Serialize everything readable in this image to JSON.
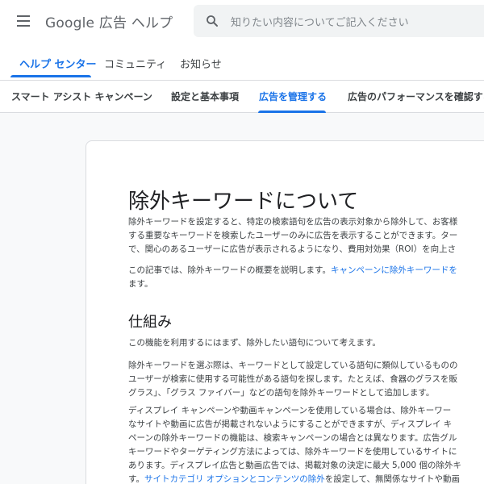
{
  "header": {
    "brand": "Google 広告 ヘルプ",
    "search_placeholder": "知りたい内容についてご記入ください"
  },
  "nav_tabs": [
    {
      "label": "ヘルプ センター",
      "active": true
    },
    {
      "label": "コミュニティ",
      "active": false
    },
    {
      "label": "お知らせ",
      "active": false
    }
  ],
  "sub_tabs": [
    {
      "label": "スマート アシスト キャンペーン",
      "active": false
    },
    {
      "label": "設定と基本事項",
      "active": false
    },
    {
      "label": "広告を管理する",
      "active": true
    },
    {
      "label": "広告のパフォーマンスを確認する",
      "active": false
    }
  ],
  "article": {
    "title": "除外キーワードについて",
    "intro_lines": [
      "除外キーワードを設定すると、特定の検索語句を広告の表示対象から除外して、お客様",
      "する重要なキーワードを検索したユーザーのみに広告を表示することができます。ター",
      "で、関心のあるユーザーに広告が表示されるようになり、費用対効果（ROI）を向上さ"
    ],
    "summary_text": "この記事では、除外キーワードの概要を説明します。",
    "summary_link": "キャンペーンに除外キーワードを",
    "summary_line2": "ます。",
    "section_heading": "仕組み",
    "section_intro": "この機能を利用するにはまず、除外したい語句について考えます。",
    "p2_lines": [
      "除外キーワードを選ぶ際は、キーワードとして設定している語句に類似しているものの",
      "ユーザーが検索に使用する可能性がある語句を探します。たとえば、食器のグラスを販",
      "グラス」、「グラス ファイバー」などの語句を除外キーワードとして追加します。"
    ],
    "p3_lines": [
      "ディスプレイ キャンペーンや動画キャンペーンを使用している場合は、除外キーワー",
      "なサイトや動画に広告が掲載されないようにすることができますが、ディスプレイ キ",
      "ペーンの除外キーワードの機能は、検索キャンペーンの場合とは異なります。広告グル",
      "キーワードやターゲティング方法によっては、除外キーワードを使用しているサイトに",
      "あります。ディスプレイ広告と動画広告では、掲載対象の決定に最大 5,000 個の除外キ"
    ],
    "p3_last_prefix": "す。",
    "p3_last_link": "サイトカテゴリ オプションとコンテンツの除外",
    "p3_last_suffix": "を設定して、無関係なサイトや動画"
  }
}
